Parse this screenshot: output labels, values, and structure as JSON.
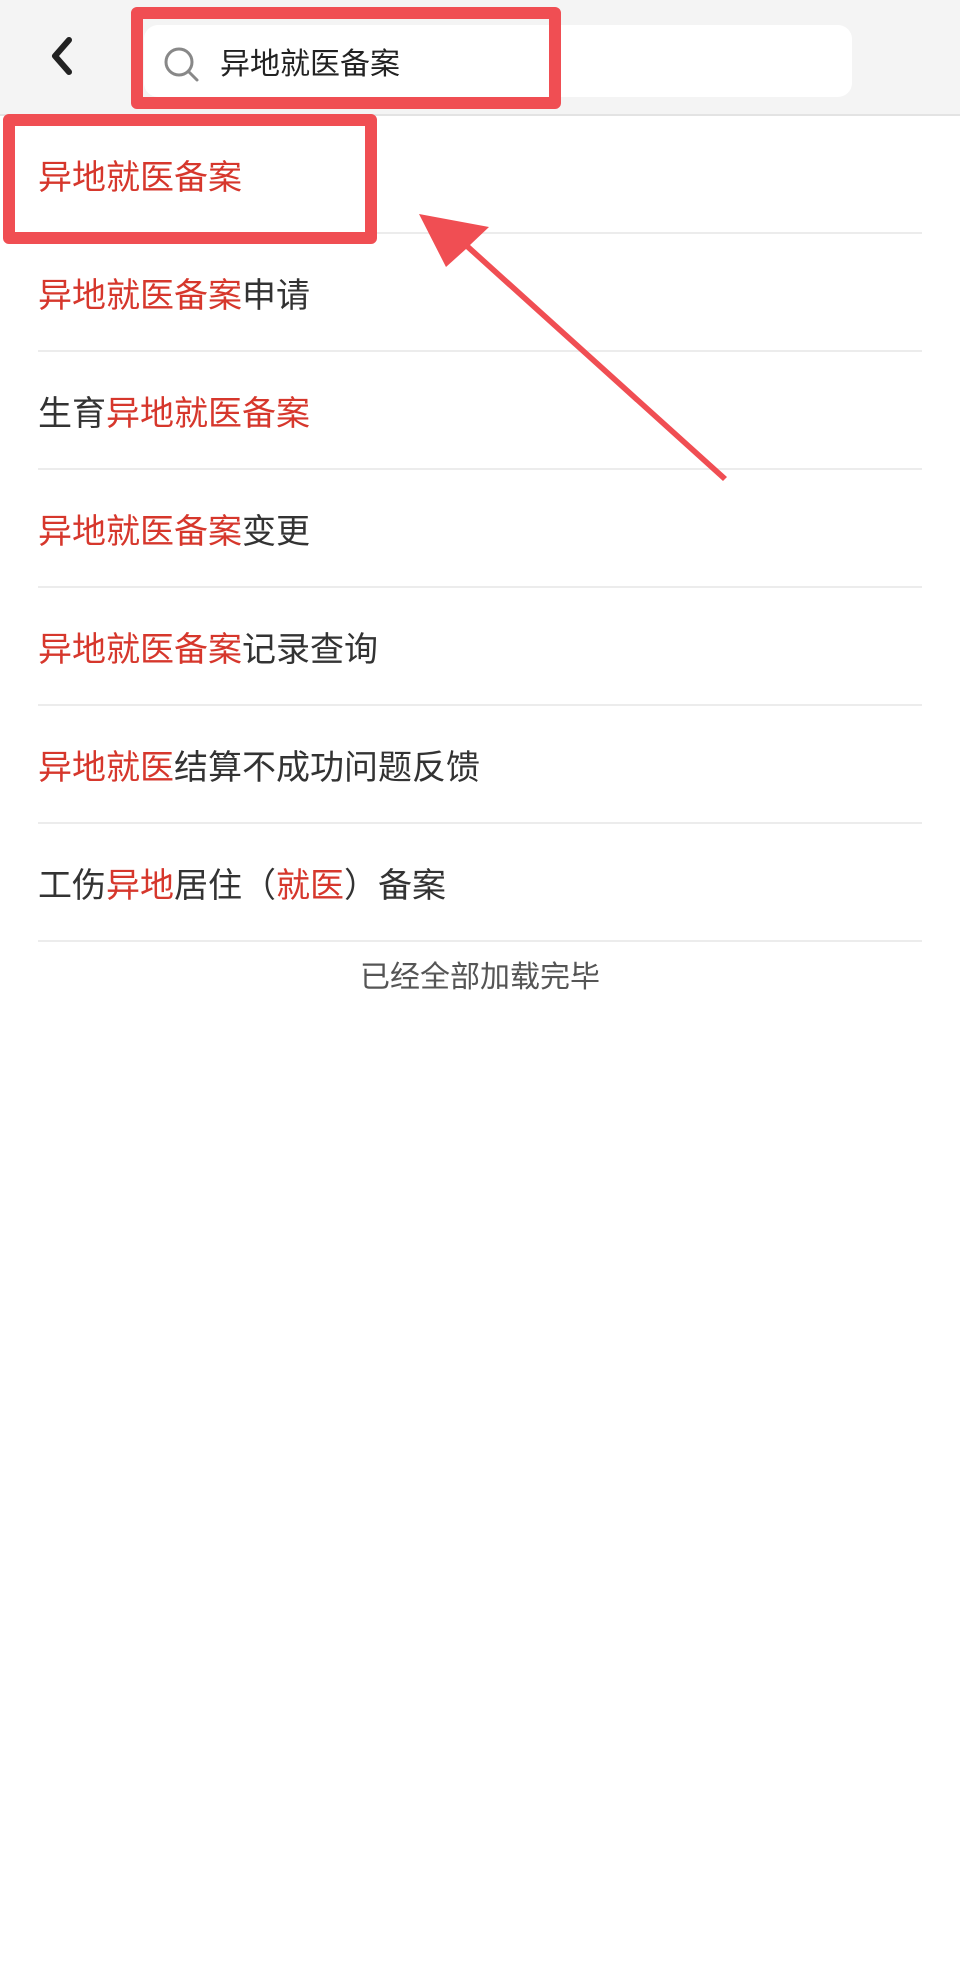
{
  "search": {
    "value": "异地就医备案"
  },
  "results": [
    {
      "segments": [
        {
          "text": "异地就医备案",
          "hl": true
        }
      ]
    },
    {
      "segments": [
        {
          "text": "异地就医备案",
          "hl": true
        },
        {
          "text": "申请",
          "hl": false
        }
      ]
    },
    {
      "segments": [
        {
          "text": "生育",
          "hl": false
        },
        {
          "text": "异地就医备案",
          "hl": true
        }
      ]
    },
    {
      "segments": [
        {
          "text": "异地就医备案",
          "hl": true
        },
        {
          "text": "变更",
          "hl": false
        }
      ]
    },
    {
      "segments": [
        {
          "text": "异地就医备案",
          "hl": true
        },
        {
          "text": "记录查询",
          "hl": false
        }
      ]
    },
    {
      "segments": [
        {
          "text": "异地就医",
          "hl": true
        },
        {
          "text": "结算不成功问题反馈",
          "hl": false
        }
      ]
    },
    {
      "segments": [
        {
          "text": "工伤",
          "hl": false
        },
        {
          "text": "异地",
          "hl": true
        },
        {
          "text": "居住（",
          "hl": false
        },
        {
          "text": "就医",
          "hl": true
        },
        {
          "text": "）备案",
          "hl": false
        }
      ]
    }
  ],
  "end_text": "已经全部加载完毕",
  "icons": {
    "back": "chevron-left-icon",
    "search": "search-icon"
  },
  "colors": {
    "highlight": "#d6372c",
    "annotation": "#f04e53"
  }
}
